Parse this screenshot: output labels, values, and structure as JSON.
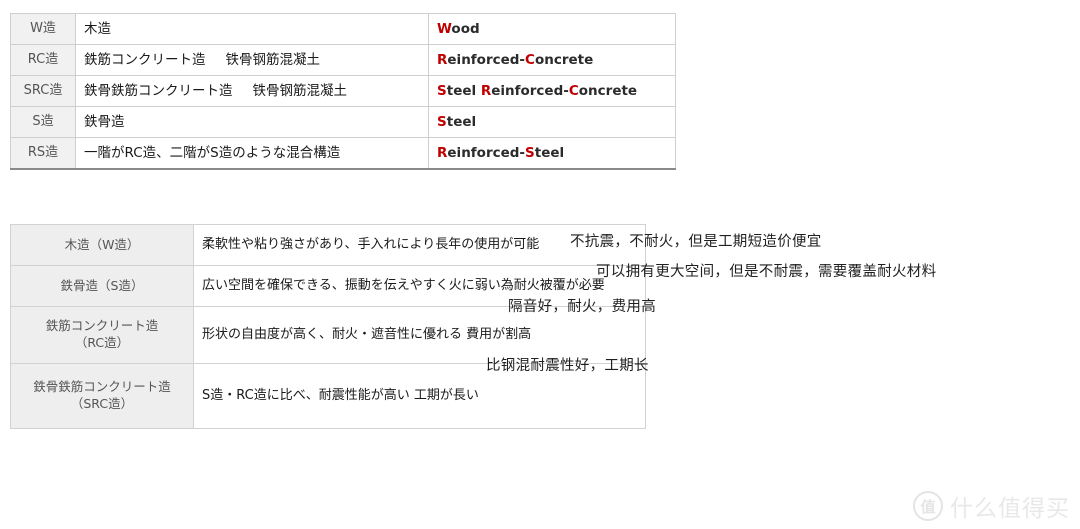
{
  "structure_code_table": {
    "name": "building-structure-abbreviation-table",
    "columns": [
      "code",
      "japanese",
      "english"
    ],
    "rows": [
      {
        "code": "W造",
        "japanese": "木造",
        "japanese_cn": "",
        "english_parts": [
          {
            "t": "W",
            "hl": true
          },
          {
            "t": "ood",
            "hl": false
          }
        ]
      },
      {
        "code": "RC造",
        "japanese": "鉄筋コンクリート造",
        "japanese_cn": "铁骨钢筋混凝土",
        "english_parts": [
          {
            "t": "R",
            "hl": true
          },
          {
            "t": "einforced-",
            "hl": false
          },
          {
            "t": "C",
            "hl": true
          },
          {
            "t": "oncrete",
            "hl": false
          }
        ]
      },
      {
        "code": "SRC造",
        "japanese": "鉄骨鉄筋コンクリート造",
        "japanese_cn": "铁骨钢筋混凝土",
        "english_parts": [
          {
            "t": "S",
            "hl": true
          },
          {
            "t": "teel ",
            "hl": false
          },
          {
            "t": "R",
            "hl": true
          },
          {
            "t": "einforced-",
            "hl": false
          },
          {
            "t": "C",
            "hl": true
          },
          {
            "t": "oncrete",
            "hl": false
          }
        ]
      },
      {
        "code": "S造",
        "japanese": "鉄骨造",
        "japanese_cn": "",
        "english_parts": [
          {
            "t": "S",
            "hl": true
          },
          {
            "t": "teel",
            "hl": false
          }
        ]
      },
      {
        "code": "RS造",
        "japanese": "一階がRC造、二階がS造のような混合構造",
        "japanese_cn": "",
        "english_parts": [
          {
            "t": "R",
            "hl": true
          },
          {
            "t": "einforced-",
            "hl": false
          },
          {
            "t": "S",
            "hl": true
          },
          {
            "t": "teel",
            "hl": false
          }
        ]
      }
    ]
  },
  "structure_feature_table": {
    "name": "building-structure-feature-table",
    "rows": [
      {
        "name": "木造（W造）",
        "description": "柔軟性や粘り強さがあり、手入れにより長年の使用が可能"
      },
      {
        "name": "鉄骨造（S造）",
        "description": "広い空間を確保できる、振動を伝えやすく火に弱い為耐火被覆が必要"
      },
      {
        "name": "鉄筋コンクリート造\n（RC造）",
        "name_line1": "鉄筋コンクリート造",
        "name_line2": "（RC造）",
        "description": "形状の自由度が高く、耐火・遮音性に優れる 費用が割高"
      },
      {
        "name": "鉄骨鉄筋コンクリート造\n（SRC造）",
        "name_line1": "鉄骨鉄筋コンクリート造",
        "name_line2": "（SRC造）",
        "description": "S造・RC造に比べ、耐震性能が高い 工期が長い"
      }
    ]
  },
  "chinese_annotations": [
    {
      "id": "note-wood",
      "text": "不抗震，不耐火，但是工期短造价便宜"
    },
    {
      "id": "note-steel",
      "text": "可以拥有更大空间，但是不耐震，需要覆盖耐火材料"
    },
    {
      "id": "note-rc",
      "text": "隔音好，耐火，费用高"
    },
    {
      "id": "note-src",
      "text": "比钢混耐震性好，工期长"
    }
  ],
  "watermark": {
    "badge": "值",
    "text": "什么值得买"
  },
  "colors": {
    "highlight_red": "#c00000",
    "header_cell_bg": "#f1f1f1",
    "feature_name_bg": "#eeeeee",
    "border": "#cfcfcf",
    "watermark": "#e8e8e8"
  }
}
